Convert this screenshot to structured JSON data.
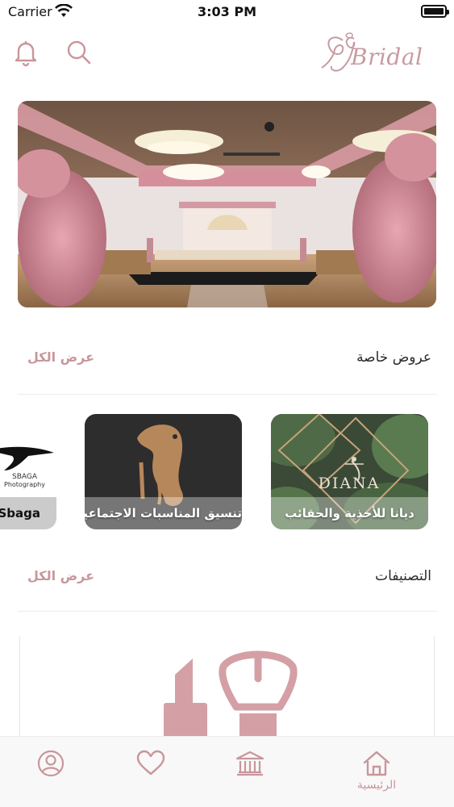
{
  "status_bar": {
    "carrier": "Carrier",
    "time": "3:03 PM"
  },
  "header": {
    "logo_text": "Bridal",
    "icons": [
      "bell-icon",
      "search-icon"
    ]
  },
  "banner": {
    "description_icon": "wedding-hall-photo"
  },
  "offers_section": {
    "title": "عروض خاصة",
    "view_all": "عرض الكل"
  },
  "offers": [
    {
      "label": "ديانا للأحذية والحقائب",
      "logo_text": "DIANA"
    },
    {
      "label": "تنسيق المناسبات الاجتماعية"
    },
    {
      "label": "Sbaga",
      "logo_text": "SBAGA",
      "logo_sub": "Photography"
    }
  ],
  "categories_section": {
    "title": "التصنيفات",
    "view_all": "عرض الكل"
  },
  "categories": [
    {
      "icon": "makeup-icon"
    }
  ],
  "tab_bar": {
    "home_label": "الرئيسية",
    "tabs": [
      "home-icon",
      "bank-icon",
      "heart-icon",
      "profile-icon"
    ],
    "active_color": "#c8969c"
  },
  "colors": {
    "accent": "#c8969c",
    "logo": "#c89aa2"
  }
}
